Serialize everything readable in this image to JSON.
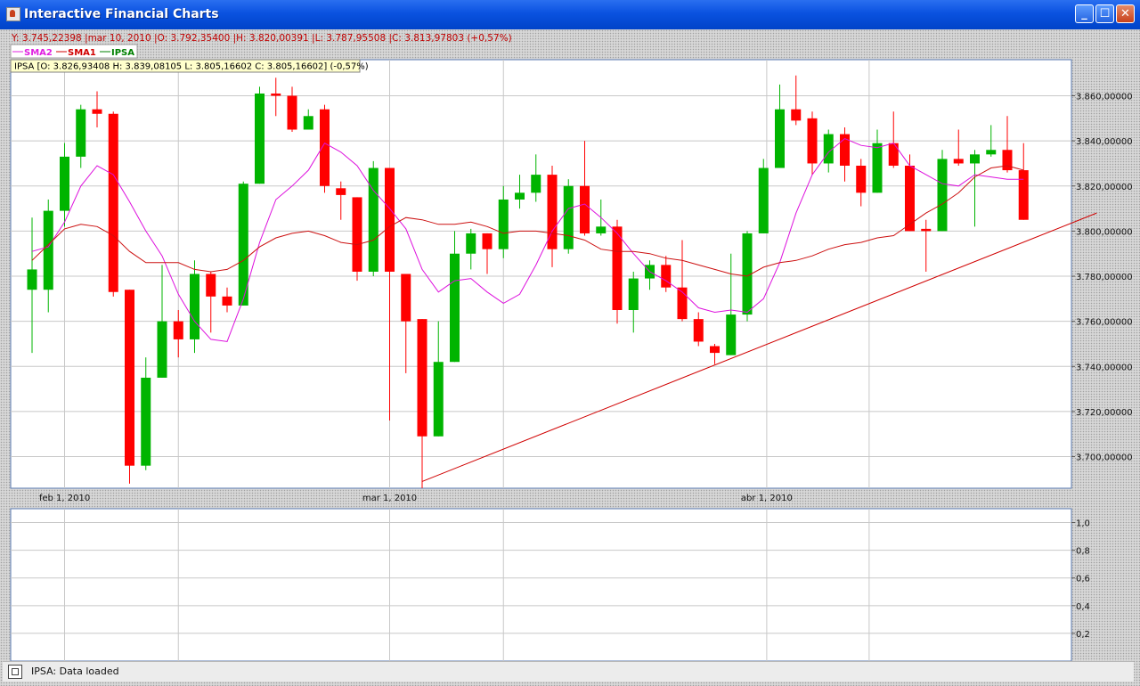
{
  "window": {
    "title": "Interactive Financial Charts"
  },
  "crosshair_info": "Y: 3.745,22398 |mar 10, 2010 |O: 3.792,35400 |H: 3.820,00391 |L: 3.787,95508 |C: 3.813,97803 (+0,57%)",
  "ohlc_info": "IPSA [O: 3.826,93408  H: 3.839,08105  L: 3.805,16602  C: 3.805,16602] (-0,57%)",
  "legend": [
    {
      "label": "SMA2",
      "color": "#e020e0"
    },
    {
      "label": "SMA1",
      "color": "#d00000"
    },
    {
      "label": "IPSA",
      "color": "#008000"
    }
  ],
  "colors": {
    "up": "#00b400",
    "down": "#ff0000",
    "sma1": "#cc1010",
    "sma2": "#dd10dd",
    "trendline": "#d00000",
    "grid": "#c8c8c8"
  },
  "status": {
    "text": "IPSA: Data loaded",
    "icon": "window-icon"
  },
  "chart_data": [
    {
      "type": "candlestick",
      "series_name": "IPSA",
      "x_ticks": [
        "feb 1, 2010",
        "mar 1, 2010",
        "abr 1, 2010"
      ],
      "y_ticks": [
        "3.700,00000",
        "3.720,00000",
        "3.740,00000",
        "3.760,00000",
        "3.780,00000",
        "3.800,00000",
        "3.820,00000",
        "3.840,00000",
        "3.860,00000"
      ],
      "ylim": [
        3686,
        3876
      ],
      "candles": [
        {
          "o": 3774,
          "h": 3806,
          "l": 3746,
          "c": 3783
        },
        {
          "o": 3774,
          "h": 3814,
          "l": 3764,
          "c": 3809
        },
        {
          "o": 3809,
          "h": 3839,
          "l": 3802,
          "c": 3833
        },
        {
          "o": 3833,
          "h": 3856,
          "l": 3828,
          "c": 3854
        },
        {
          "o": 3854,
          "h": 3862,
          "l": 3846,
          "c": 3852
        },
        {
          "o": 3852,
          "h": 3853,
          "l": 3771,
          "c": 3773
        },
        {
          "o": 3774,
          "h": 3774,
          "l": 3688,
          "c": 3696
        },
        {
          "o": 3696,
          "h": 3744,
          "l": 3694,
          "c": 3735
        },
        {
          "o": 3735,
          "h": 3785,
          "l": 3735,
          "c": 3760
        },
        {
          "o": 3760,
          "h": 3765,
          "l": 3744,
          "c": 3752
        },
        {
          "o": 3752,
          "h": 3787,
          "l": 3746,
          "c": 3781
        },
        {
          "o": 3781,
          "h": 3782,
          "l": 3755,
          "c": 3771
        },
        {
          "o": 3771,
          "h": 3775,
          "l": 3764,
          "c": 3767
        },
        {
          "o": 3767,
          "h": 3822,
          "l": 3767,
          "c": 3821
        },
        {
          "o": 3821,
          "h": 3864,
          "l": 3821,
          "c": 3861
        },
        {
          "o": 3861,
          "h": 3868,
          "l": 3851,
          "c": 3860
        },
        {
          "o": 3860,
          "h": 3864,
          "l": 3844,
          "c": 3845
        },
        {
          "o": 3845,
          "h": 3854,
          "l": 3845,
          "c": 3851
        },
        {
          "o": 3854,
          "h": 3856,
          "l": 3817,
          "c": 3820
        },
        {
          "o": 3819,
          "h": 3822,
          "l": 3805,
          "c": 3816
        },
        {
          "o": 3815,
          "h": 3815,
          "l": 3778,
          "c": 3782
        },
        {
          "o": 3782,
          "h": 3831,
          "l": 3780,
          "c": 3828
        },
        {
          "o": 3828,
          "h": 3828,
          "l": 3716,
          "c": 3782
        },
        {
          "o": 3781,
          "h": 3781,
          "l": 3737,
          "c": 3760
        },
        {
          "o": 3761,
          "h": 3761,
          "l": 3686,
          "c": 3709
        },
        {
          "o": 3709,
          "h": 3760,
          "l": 3709,
          "c": 3742
        },
        {
          "o": 3742,
          "h": 3800,
          "l": 3742,
          "c": 3790
        },
        {
          "o": 3790,
          "h": 3801,
          "l": 3783,
          "c": 3799
        },
        {
          "o": 3799,
          "h": 3799,
          "l": 3781,
          "c": 3792
        },
        {
          "o": 3792,
          "h": 3820,
          "l": 3788,
          "c": 3814
        },
        {
          "o": 3814,
          "h": 3825,
          "l": 3810,
          "c": 3817
        },
        {
          "o": 3817,
          "h": 3834,
          "l": 3813,
          "c": 3825
        },
        {
          "o": 3825,
          "h": 3829,
          "l": 3784,
          "c": 3792
        },
        {
          "o": 3792,
          "h": 3823,
          "l": 3790,
          "c": 3820
        },
        {
          "o": 3820,
          "h": 3840,
          "l": 3798,
          "c": 3799
        },
        {
          "o": 3799,
          "h": 3814,
          "l": 3798,
          "c": 3802
        },
        {
          "o": 3802,
          "h": 3805,
          "l": 3759,
          "c": 3765
        },
        {
          "o": 3765,
          "h": 3782,
          "l": 3755,
          "c": 3779
        },
        {
          "o": 3779,
          "h": 3787,
          "l": 3774,
          "c": 3785
        },
        {
          "o": 3785,
          "h": 3789,
          "l": 3773,
          "c": 3775
        },
        {
          "o": 3775,
          "h": 3796,
          "l": 3760,
          "c": 3761
        },
        {
          "o": 3761,
          "h": 3764,
          "l": 3749,
          "c": 3751
        },
        {
          "o": 3749,
          "h": 3750,
          "l": 3741,
          "c": 3746
        },
        {
          "o": 3745,
          "h": 3790,
          "l": 3745,
          "c": 3763
        },
        {
          "o": 3763,
          "h": 3800,
          "l": 3760,
          "c": 3799
        },
        {
          "o": 3799,
          "h": 3832,
          "l": 3799,
          "c": 3828
        },
        {
          "o": 3828,
          "h": 3865,
          "l": 3828,
          "c": 3854
        },
        {
          "o": 3854,
          "h": 3869,
          "l": 3847,
          "c": 3849
        },
        {
          "o": 3850,
          "h": 3853,
          "l": 3825,
          "c": 3830
        },
        {
          "o": 3830,
          "h": 3845,
          "l": 3826,
          "c": 3843
        },
        {
          "o": 3843,
          "h": 3846,
          "l": 3822,
          "c": 3829
        },
        {
          "o": 3829,
          "h": 3832,
          "l": 3811,
          "c": 3817
        },
        {
          "o": 3817,
          "h": 3845,
          "l": 3817,
          "c": 3839
        },
        {
          "o": 3839,
          "h": 3853,
          "l": 3828,
          "c": 3829
        },
        {
          "o": 3829,
          "h": 3834,
          "l": 3800,
          "c": 3800
        },
        {
          "o": 3801,
          "h": 3805,
          "l": 3782,
          "c": 3800
        },
        {
          "o": 3800,
          "h": 3836,
          "l": 3800,
          "c": 3832
        },
        {
          "o": 3832,
          "h": 3845,
          "l": 3829,
          "c": 3830
        },
        {
          "o": 3830,
          "h": 3836,
          "l": 3802,
          "c": 3834
        },
        {
          "o": 3834,
          "h": 3847,
          "l": 3833,
          "c": 3836
        },
        {
          "o": 3836,
          "h": 3851,
          "l": 3826,
          "c": 3827
        },
        {
          "o": 3827,
          "h": 3839,
          "l": 3805,
          "c": 3805
        }
      ],
      "sma1": [
        3787,
        3794,
        3801,
        3803,
        3802,
        3798,
        3791,
        3786,
        3786,
        3786,
        3783,
        3782,
        3783,
        3787,
        3793,
        3797,
        3799,
        3800,
        3798,
        3795,
        3794,
        3796,
        3802,
        3806,
        3805,
        3803,
        3803,
        3804,
        3802,
        3799,
        3800,
        3800,
        3799,
        3798,
        3796,
        3792,
        3791,
        3791,
        3790,
        3788,
        3787,
        3785,
        3783,
        3781,
        3780,
        3784,
        3786,
        3787,
        3789,
        3792,
        3794,
        3795,
        3797,
        3798,
        3803,
        3808,
        3812,
        3817,
        3824,
        3828,
        3829,
        3827
      ],
      "sma2": [
        3791,
        3793,
        3804,
        3820,
        3829,
        3825,
        3813,
        3800,
        3789,
        3772,
        3760,
        3752,
        3751,
        3770,
        3795,
        3814,
        3820,
        3827,
        3839,
        3835,
        3829,
        3818,
        3810,
        3801,
        3783,
        3773,
        3778,
        3779,
        3773,
        3768,
        3772,
        3785,
        3800,
        3810,
        3812,
        3806,
        3799,
        3790,
        3782,
        3778,
        3773,
        3766,
        3764,
        3765,
        3764,
        3770,
        3786,
        3808,
        3825,
        3835,
        3841,
        3838,
        3837,
        3839,
        3829,
        3825,
        3821,
        3820,
        3825,
        3824,
        3823,
        3823
      ],
      "trendline": {
        "from": {
          "index": 24,
          "y": 3689
        },
        "to": {
          "index": 65.5,
          "y": 3808
        }
      }
    },
    {
      "type": "line",
      "series_name": "",
      "y_ticks": [
        "1,0",
        "0,8",
        "0,6",
        "0,4",
        "0,2"
      ],
      "ylim": [
        0,
        1.1
      ],
      "values": []
    }
  ]
}
